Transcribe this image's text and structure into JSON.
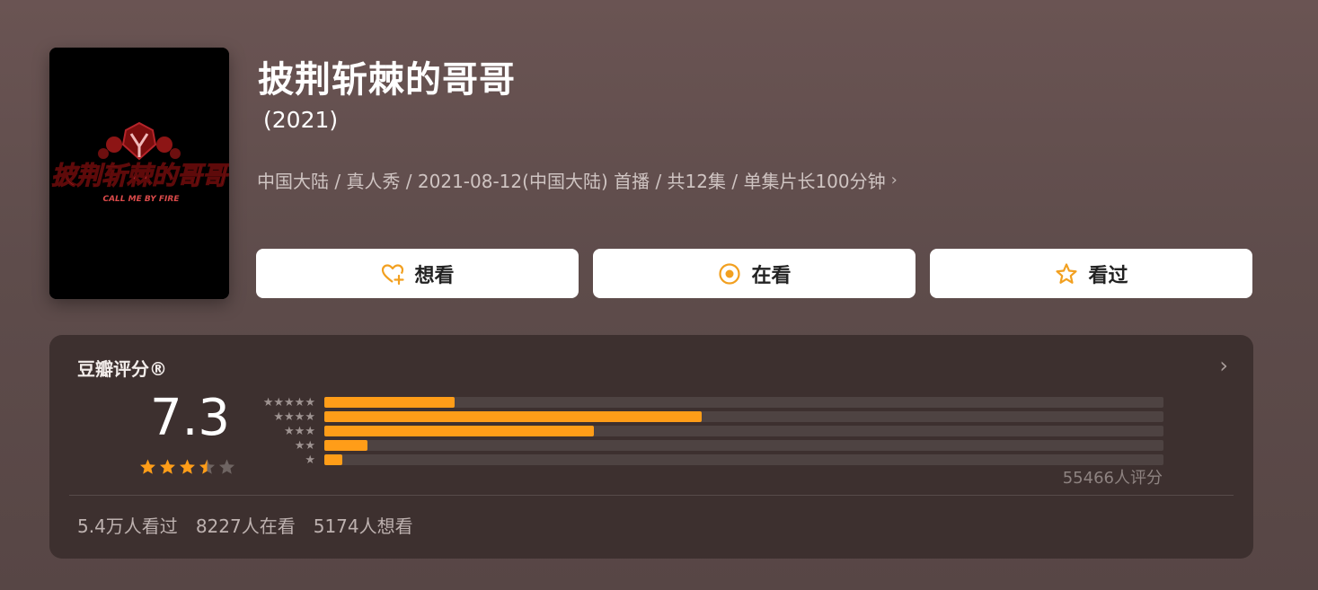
{
  "show": {
    "title": "披荆斩棘的哥哥",
    "year": "(2021)",
    "meta": "中国大陆 / 真人秀 / 2021-08-12(中国大陆) 首播 / 共12集 / 单集片长100分钟",
    "poster_text_cn": "披荆斩棘的哥哥",
    "poster_text_en": "CALL ME BY FIRE"
  },
  "actions": {
    "want_label": "想看",
    "watching_label": "在看",
    "watched_label": "看过"
  },
  "rating": {
    "title": "豆瓣评分®",
    "score": "7.3",
    "score_stars": 3.5,
    "total": "55466人评分",
    "distribution": [
      {
        "stars": 5,
        "fraction": 0.155
      },
      {
        "stars": 4,
        "fraction": 0.45
      },
      {
        "stars": 3,
        "fraction": 0.321
      },
      {
        "stars": 2,
        "fraction": 0.051
      },
      {
        "stars": 1,
        "fraction": 0.021
      }
    ],
    "stats": {
      "watched": "5.4万人看过",
      "watching": "8227人在看",
      "want": "5174人想看"
    }
  },
  "colors": {
    "accent": "#ff9d18",
    "card_bg": "#3d302f",
    "page_bg": "#6a5453"
  }
}
